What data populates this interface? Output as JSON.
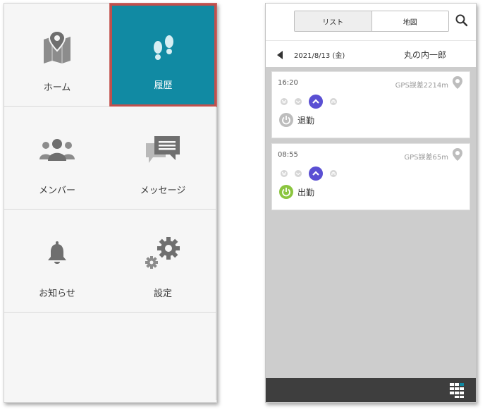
{
  "menu": {
    "tiles": [
      {
        "label": "ホーム",
        "icon": "map-pin-icon",
        "active": false
      },
      {
        "label": "履歴",
        "icon": "footprints-icon",
        "active": true
      },
      {
        "label": "メンバー",
        "icon": "members-icon",
        "active": false
      },
      {
        "label": "メッセージ",
        "icon": "message-icon",
        "active": false
      },
      {
        "label": "お知らせ",
        "icon": "bell-icon",
        "active": false
      },
      {
        "label": "設定",
        "icon": "gear-icon",
        "active": false
      }
    ],
    "active_color": "#118aa3",
    "highlight_color": "#c0504d"
  },
  "history": {
    "tabs": [
      {
        "label": "リスト",
        "selected": true
      },
      {
        "label": "地図",
        "selected": false
      }
    ],
    "date": "2021/8/13 (金)",
    "user_name": "丸の内一郎",
    "entries": [
      {
        "time": "16:20",
        "gps": "GPS誤差2214m",
        "action": "退勤",
        "status_color": "#bdbdbd"
      },
      {
        "time": "08:55",
        "gps": "GPS誤差65m",
        "action": "出勤",
        "status_color": "#8bc53f"
      }
    ],
    "accent_color": "#5a4fd3"
  }
}
